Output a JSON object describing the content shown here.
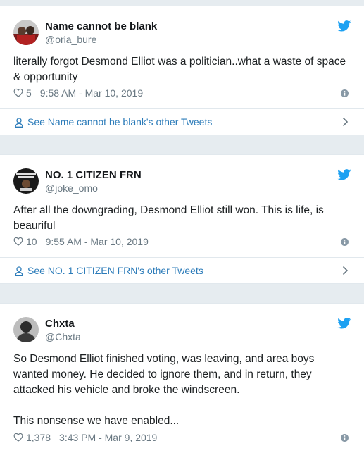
{
  "tweets": [
    {
      "name": "Name cannot be blank",
      "handle": "@oria_bure",
      "text": "literally forgot Desmond Elliot was a politician..what a waste of space & opportunity",
      "likes": "5",
      "time": "9:58 AM - Mar 10, 2019",
      "other_tweets": "See Name cannot be blank's other Tweets"
    },
    {
      "name": "NO. 1 CITIZEN FRN",
      "handle": "@joke_omo",
      "text": "After all the downgrading, Desmond Elliot still won. This is life, is beauriful",
      "likes": "10",
      "time": "9:55 AM - Mar 10, 2019",
      "other_tweets": "See NO. 1 CITIZEN FRN's other Tweets"
    },
    {
      "name": "Chxta",
      "handle": "@Chxta",
      "text": "So Desmond Elliot finished voting, was leaving, and area boys wanted money. He decided to ignore them, and in return, they attacked his vehicle and broke the windscreen.",
      "text2": "This nonsense we have enabled...",
      "likes": "1,378",
      "time": "3:43 PM - Mar 9, 2019"
    }
  ],
  "colors": {
    "twitter_blue": "#1da1f2",
    "link_blue": "#2b7bb9",
    "muted": "#697882",
    "background": "#e6ecf0"
  },
  "icons": [
    "twitter-bird-icon",
    "heart-icon",
    "info-icon",
    "person-icon",
    "chevron-right-icon"
  ]
}
